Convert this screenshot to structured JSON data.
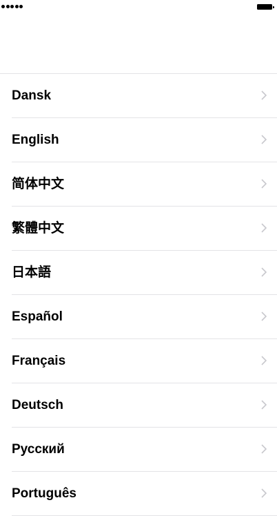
{
  "status_bar": {
    "signal_icon": "signal-dots-icon",
    "battery_icon": "battery-icon"
  },
  "languages": [
    "Dansk",
    "English",
    "简体中文",
    "繁體中文",
    "日本語",
    "Español",
    "Français",
    "Deutsch",
    "Русский",
    "Português"
  ],
  "row_chevron_icon": "chevron-right-icon",
  "colors": {
    "background": "#ffffff",
    "text": "#000000",
    "separator": "#e3e3e6",
    "chevron": "#c7c7cc"
  }
}
